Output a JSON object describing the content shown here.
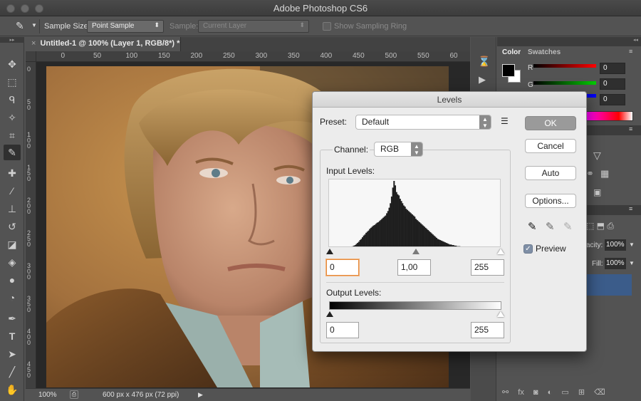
{
  "app": {
    "title": "Adobe Photoshop CS6"
  },
  "options_bar": {
    "sample_size_label": "Sample Size:",
    "sample_size_value": "Point Sample",
    "sample_label": "Sample:",
    "sample_value": "Current Layer",
    "show_ring_label": "Show Sampling Ring"
  },
  "document": {
    "tab_title": "Untitled-1 @ 100% (Layer 1, RGB/8*) *",
    "ruler_h_ticks": [
      "50",
      "0",
      "50",
      "100",
      "150",
      "200",
      "250",
      "300",
      "350",
      "400",
      "450",
      "500",
      "550",
      "60"
    ],
    "ruler_v_ticks": [
      "0",
      "5 0",
      "1 0 0",
      "1 5 0",
      "2 0 0",
      "2 5 0",
      "3 0 0",
      "3 5 0",
      "4 0 0",
      "4 5 0"
    ],
    "zoom": "100%",
    "size_info": "600 px x 476 px (72 ppi)"
  },
  "panels": {
    "tabs": [
      "Color",
      "Swatches"
    ],
    "color": {
      "r_label": "R",
      "g_label": "G",
      "r_value": "0",
      "g_value": "0",
      "b_value": "0"
    },
    "layers": {
      "opacity_label": "acity:",
      "opacity_value": "100%",
      "fill_label": "Fill:",
      "fill_value": "100%"
    }
  },
  "levels_dialog": {
    "title": "Levels",
    "preset_label": "Preset:",
    "preset_value": "Default",
    "channel_label": "Channel:",
    "channel_value": "RGB",
    "input_levels_label": "Input Levels:",
    "input_black": "0",
    "input_gamma": "1,00",
    "input_white": "255",
    "output_levels_label": "Output Levels:",
    "output_black": "0",
    "output_white": "255",
    "buttons": {
      "ok": "OK",
      "cancel": "Cancel",
      "auto": "Auto",
      "options": "Options..."
    },
    "preview_label": "Preview",
    "preview_checked": true,
    "histogram": [
      0,
      0,
      0,
      0,
      0,
      0,
      0,
      0,
      0,
      0,
      0,
      0,
      0,
      0,
      0,
      0,
      1,
      1,
      2,
      3,
      4,
      5,
      7,
      9,
      11,
      14,
      16,
      19,
      22,
      24,
      27,
      29,
      31,
      34,
      36,
      38,
      40,
      41,
      43,
      45,
      46,
      48,
      50,
      52,
      54,
      56,
      58,
      62,
      66,
      72,
      80,
      92,
      108,
      120,
      112,
      100,
      96,
      94,
      88,
      84,
      80,
      76,
      74,
      70,
      68,
      66,
      64,
      62,
      60,
      58,
      56,
      52,
      50,
      48,
      46,
      44,
      42,
      40,
      38,
      36,
      34,
      32,
      30,
      28,
      26,
      24,
      22,
      20,
      18,
      16,
      15,
      14,
      13,
      12,
      11,
      10,
      9,
      8,
      7,
      6,
      6,
      5,
      5,
      4,
      4,
      3,
      3,
      3,
      2,
      2,
      2,
      2,
      1,
      1,
      1,
      1,
      1,
      1,
      0,
      0,
      0,
      0,
      0,
      0,
      0,
      0,
      0,
      0,
      0,
      0,
      0,
      0,
      0,
      0,
      0,
      0,
      0,
      0,
      0,
      0,
      0,
      0
    ]
  },
  "colors": {
    "accent_selection": "#3b5c8a",
    "ok_button": "#9a9a9a"
  }
}
